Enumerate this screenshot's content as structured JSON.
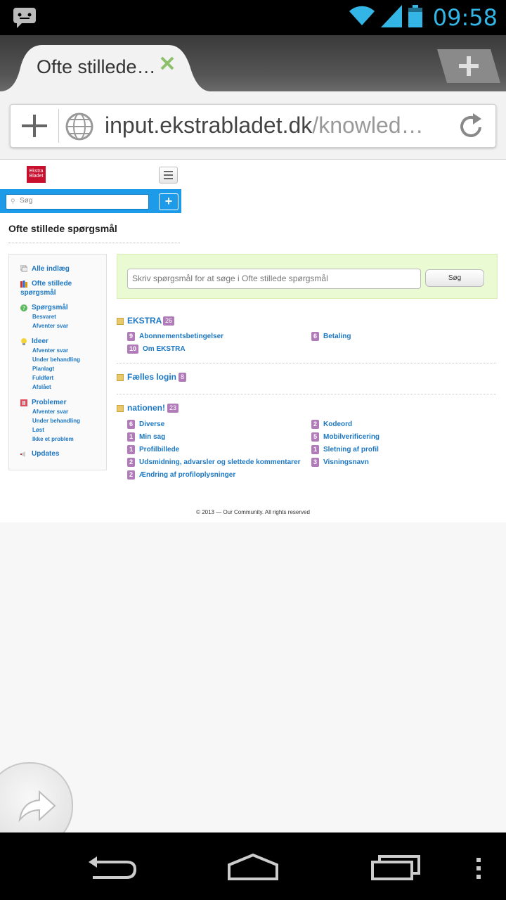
{
  "status_bar": {
    "time": "09:58"
  },
  "browser": {
    "tab_title": "Ofte stillede…",
    "url_host": "input.ekstrabladet.dk",
    "url_path": "/knowled…"
  },
  "site": {
    "logo_line1": "Ekstra",
    "logo_line2": "Bladet",
    "search_placeholder": "Søg",
    "search_plus": "+"
  },
  "page": {
    "title": "Ofte stillede spørgsmål",
    "faq_search_placeholder": "Skriv spørgsmål for at søge i Ofte stillede spørgsmål",
    "faq_search_button": "Søg",
    "footer": "© 2013 — Our Community. All rights reserved"
  },
  "sidebar": {
    "all": "Alle indlæg",
    "faq_line1": "Ofte stillede",
    "faq_line2": "spørgsmål",
    "questions": "Spørgsmål",
    "questions_sub": [
      "Besvaret",
      "Afventer svar"
    ],
    "ideas": "Ideer",
    "ideas_sub": [
      "Afventer svar",
      "Under behandling",
      "Planlagt",
      "Fuldført",
      "Afslået"
    ],
    "problems": "Problemer",
    "problems_sub": [
      "Afventer svar",
      "Under behandling",
      "Løst",
      "Ikke et problem"
    ],
    "updates": "Updates"
  },
  "categories": [
    {
      "name": "EKSTRA",
      "count": "26",
      "articles": [
        {
          "count": "9",
          "title": "Abonnementsbetingelser"
        },
        {
          "count": "6",
          "title": "Betaling"
        },
        {
          "count": "10",
          "title": "Om EKSTRA"
        }
      ]
    },
    {
      "name": "Fælles login",
      "count": "8",
      "articles": []
    },
    {
      "name": "nationen!",
      "count": "23",
      "articles": [
        {
          "count": "6",
          "title": "Diverse"
        },
        {
          "count": "2",
          "title": "Kodeord"
        },
        {
          "count": "1",
          "title": "Min sag"
        },
        {
          "count": "5",
          "title": "Mobilverificering"
        },
        {
          "count": "1",
          "title": "Profilbillede"
        },
        {
          "count": "1",
          "title": "Sletning af profil"
        },
        {
          "count": "2",
          "title": "Udsmidning, advarsler og slettede kommentarer"
        },
        {
          "count": "3",
          "title": "Visningsnavn"
        },
        {
          "count": "2",
          "title": "Ændring af profiloplysninger"
        }
      ]
    }
  ],
  "colors": {
    "accent": "#33b5e5",
    "link": "#1c77c3",
    "badge": "#b07bb8",
    "search_bar": "#1e9be8"
  }
}
